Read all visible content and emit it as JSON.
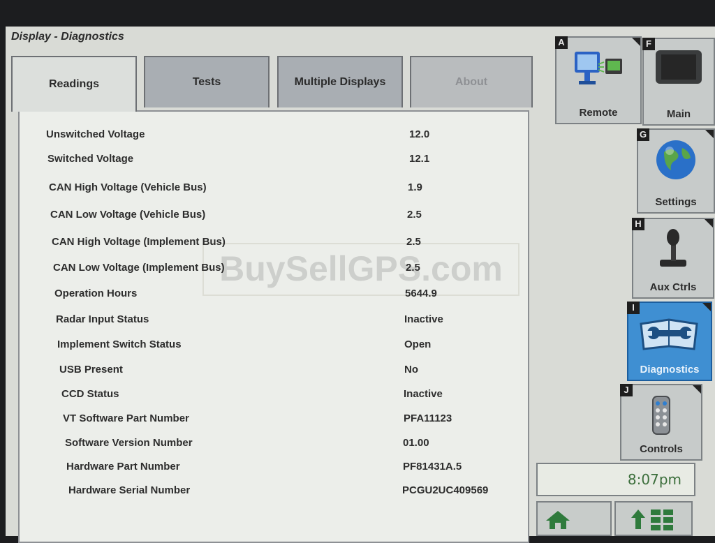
{
  "window": {
    "title": "Display - Diagnostics"
  },
  "tabs": [
    {
      "label": "Readings",
      "state": "active"
    },
    {
      "label": "Tests",
      "state": "normal"
    },
    {
      "label": "Multiple Displays",
      "state": "normal"
    },
    {
      "label": "About",
      "state": "disabled"
    }
  ],
  "readings": [
    {
      "label": "Unswitched Voltage",
      "value": "12.0"
    },
    {
      "label": "Switched Voltage",
      "value": "12.1"
    },
    {
      "label": "CAN High Voltage (Vehicle Bus)",
      "value": "1.9"
    },
    {
      "label": "CAN Low Voltage (Vehicle Bus)",
      "value": "2.5"
    },
    {
      "label": "CAN High Voltage (Implement Bus)",
      "value": "2.5"
    },
    {
      "label": "CAN Low Voltage (Implement Bus)",
      "value": "2.5"
    },
    {
      "label": "Operation Hours",
      "value": "5644.9"
    },
    {
      "label": "Radar Input Status",
      "value": "Inactive"
    },
    {
      "label": "Implement Switch Status",
      "value": "Open"
    },
    {
      "label": "USB Present",
      "value": "No"
    },
    {
      "label": "CCD Status",
      "value": "Inactive"
    },
    {
      "label": "VT Software Part Number",
      "value": "PFA11123"
    },
    {
      "label": "Software Version Number",
      "value": "01.00"
    },
    {
      "label": "Hardware Part Number",
      "value": "PF81431A.5"
    },
    {
      "label": "Hardware Serial Number",
      "value": "PCGU2UC409569"
    }
  ],
  "watermark": "BuySellGPS.com",
  "softkeys": {
    "remote": {
      "key": "A",
      "label": "Remote",
      "icon": "remote-monitors-icon"
    },
    "main": {
      "key": "F",
      "label": "Main",
      "icon": "display-screen-icon"
    },
    "settings": {
      "key": "G",
      "label": "Settings",
      "icon": "globe-icon"
    },
    "aux": {
      "key": "H",
      "label": "Aux Ctrls",
      "icon": "joystick-icon"
    },
    "diagnostics": {
      "key": "I",
      "label": "Diagnostics",
      "icon": "wrench-book-icon",
      "selected": true
    },
    "controls": {
      "key": "J",
      "label": "Controls",
      "icon": "remote-control-icon"
    }
  },
  "clock": "8:07pm",
  "bottom": {
    "home_icon": "home-icon",
    "menu_icon": "up-arrow-grid-icon"
  },
  "colors": {
    "selected_softkey": "#3f8fd2",
    "clock_text": "#3b6e3b"
  }
}
